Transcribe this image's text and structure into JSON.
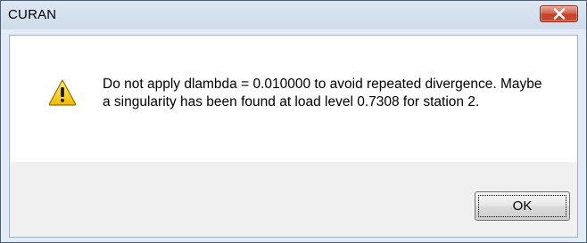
{
  "window": {
    "title": "CURAN",
    "close_icon": "close-icon"
  },
  "dialog": {
    "icon": "warning-icon",
    "message": "Do not apply dlambda = 0.010000 to avoid repeated divergence. Maybe a singularity has been found at load level 0.7308 for station 2.",
    "ok_label": "OK"
  },
  "colors": {
    "close_button": "#c8442c",
    "warning_fill": "#f5c400"
  }
}
